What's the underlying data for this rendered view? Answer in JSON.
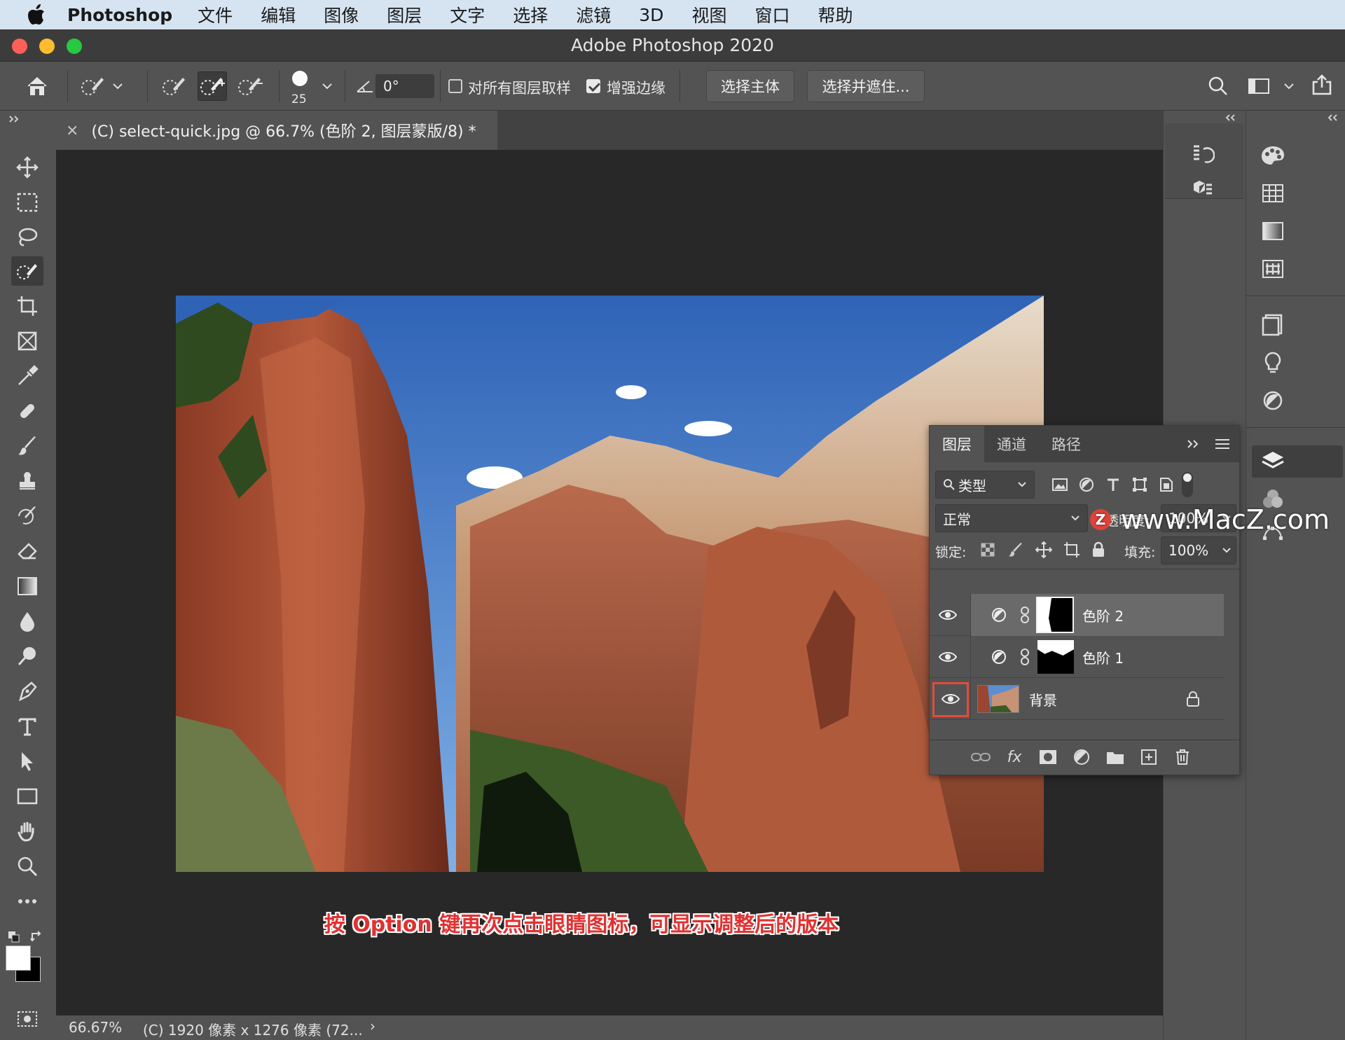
{
  "menubar": {
    "app_name": "Photoshop",
    "items": [
      "文件",
      "编辑",
      "图像",
      "图层",
      "文字",
      "选择",
      "滤镜",
      "3D",
      "视图",
      "窗口",
      "帮助"
    ]
  },
  "window": {
    "title": "Adobe Photoshop 2020"
  },
  "options_bar": {
    "brush_size": "25",
    "angle_value": "0°",
    "sample_all_layers_label": "对所有图层取样",
    "sample_all_layers_checked": false,
    "enhance_edge_label": "增强边缘",
    "enhance_edge_checked": true,
    "select_subject_label": "选择主体",
    "select_and_mask_label": "选择并遮住..."
  },
  "document_tab": {
    "title": "(C) select-quick.jpg @ 66.7% (色阶 2, 图层蒙版/8) *"
  },
  "status_bar": {
    "zoom": "66.67%",
    "doc_info": "(C) 1920 像素 x 1276 像素 (72..."
  },
  "layers_panel": {
    "tabs": [
      "图层",
      "通道",
      "路径"
    ],
    "active_tab": "图层",
    "filter_label": "类型",
    "blend_mode": "正常",
    "opacity_label": "不透明度:",
    "opacity_value": "100%",
    "lock_label": "锁定:",
    "fill_label": "填充:",
    "fill_value": "100%",
    "layers": [
      {
        "name": "色阶 2",
        "type": "adjustment",
        "visible": true,
        "selected": true
      },
      {
        "name": "色阶 1",
        "type": "adjustment",
        "visible": true,
        "selected": false
      },
      {
        "name": "背景",
        "type": "image",
        "visible": true,
        "locked": true,
        "highlighted_eye": true
      }
    ]
  },
  "caption": "按 Option 键再次点击眼睛图标，可显示调整后的版本",
  "watermark": "www.MacZ.com",
  "colors": {
    "caption_red": "#e03232",
    "highlight_red": "#e64a3c",
    "menubar": "#d6e4f2"
  }
}
